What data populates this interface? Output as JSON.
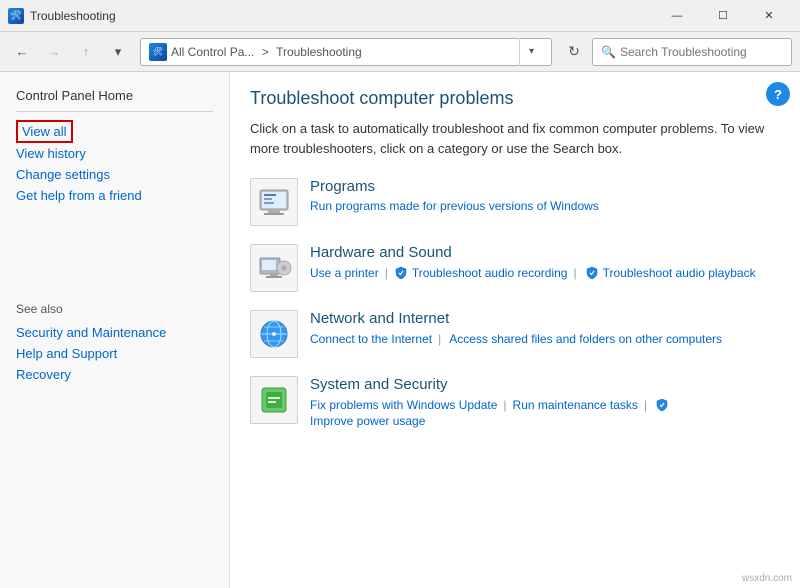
{
  "window": {
    "title": "Troubleshooting",
    "icon": "🛠"
  },
  "titlebar": {
    "minimize": "—",
    "maximize": "☐",
    "close": "✕"
  },
  "navbar": {
    "back": "←",
    "forward": "→",
    "up": "↑",
    "recent": "▾",
    "address": {
      "icon": "🛠",
      "path1": "All Control Pa...",
      "separator": ">",
      "path2": "Troubleshooting"
    },
    "refresh": "↻",
    "search_placeholder": "Search Troubleshooting"
  },
  "sidebar": {
    "home_label": "Control Panel Home",
    "links": [
      {
        "id": "view-all",
        "label": "View all",
        "highlighted": true
      },
      {
        "id": "view-history",
        "label": "View history",
        "highlighted": false
      },
      {
        "id": "change-settings",
        "label": "Change settings",
        "highlighted": false
      },
      {
        "id": "get-help",
        "label": "Get help from a friend",
        "highlighted": false
      }
    ],
    "see_also_label": "See also",
    "see_also_links": [
      {
        "id": "security-maintenance",
        "label": "Security and Maintenance"
      },
      {
        "id": "help-support",
        "label": "Help and Support"
      },
      {
        "id": "recovery",
        "label": "Recovery"
      }
    ]
  },
  "content": {
    "title": "Troubleshoot computer problems",
    "description": "Click on a task to automatically troubleshoot and fix common computer problems. To view more troubleshooters, click on a category or use the Search box.",
    "categories": [
      {
        "id": "programs",
        "name": "Programs",
        "links": [
          {
            "label": "Run programs made for previous versions of Windows",
            "type": "plain"
          }
        ]
      },
      {
        "id": "hardware-sound",
        "name": "Hardware and Sound",
        "links": [
          {
            "label": "Use a printer",
            "type": "plain"
          },
          {
            "label": "Troubleshoot audio recording",
            "type": "shield"
          },
          {
            "label": "Troubleshoot audio playback",
            "type": "shield"
          }
        ]
      },
      {
        "id": "network-internet",
        "name": "Network and Internet",
        "links": [
          {
            "label": "Connect to the Internet",
            "type": "plain"
          },
          {
            "label": "Access shared files and folders on other computers",
            "type": "plain"
          }
        ]
      },
      {
        "id": "system-security",
        "name": "System and Security",
        "links": [
          {
            "label": "Fix problems with Windows Update",
            "type": "plain"
          },
          {
            "label": "Run maintenance tasks",
            "type": "plain"
          },
          {
            "label": "Improve power usage",
            "type": "shield"
          }
        ]
      }
    ]
  },
  "watermark": "wsxdn.com"
}
